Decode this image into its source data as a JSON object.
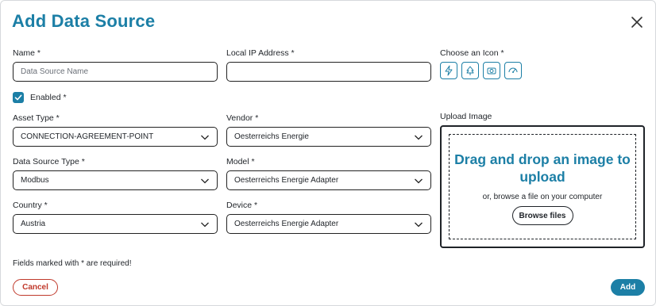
{
  "dialog": {
    "title": "Add Data Source",
    "close_icon": "close-icon"
  },
  "form": {
    "name": {
      "label": "Name *",
      "placeholder": "Data Source Name",
      "value": ""
    },
    "local_ip": {
      "label": "Local IP Address *",
      "value": ""
    },
    "choose_icon": {
      "label": "Choose an Icon *",
      "icons": [
        "lightning-icon",
        "plant-icon",
        "camera-icon",
        "gauge-icon"
      ]
    },
    "enabled": {
      "label": "Enabled *",
      "checked": true
    },
    "asset_type": {
      "label": "Asset Type *",
      "value": "CONNECTION-AGREEMENT-POINT"
    },
    "vendor": {
      "label": "Vendor *",
      "value": "Oesterreichs Energie"
    },
    "data_source_type": {
      "label": "Data Source Type *",
      "value": "Modbus"
    },
    "model": {
      "label": "Model *",
      "value": "Oesterreichs Energie Adapter"
    },
    "country": {
      "label": "Country *",
      "value": "Austria"
    },
    "device": {
      "label": "Device *",
      "value": "Oesterreichs Energie Adapter"
    }
  },
  "upload": {
    "label": "Upload Image",
    "title": "Drag and drop an image to upload",
    "browse_text": "or, browse a file on your computer",
    "browse_button": "Browse files"
  },
  "footer": {
    "required_note": "Fields marked with * are required!",
    "cancel_label": "Cancel",
    "add_label": "Add"
  },
  "colors": {
    "accent": "#1c7fa6",
    "danger": "#c0392b"
  }
}
